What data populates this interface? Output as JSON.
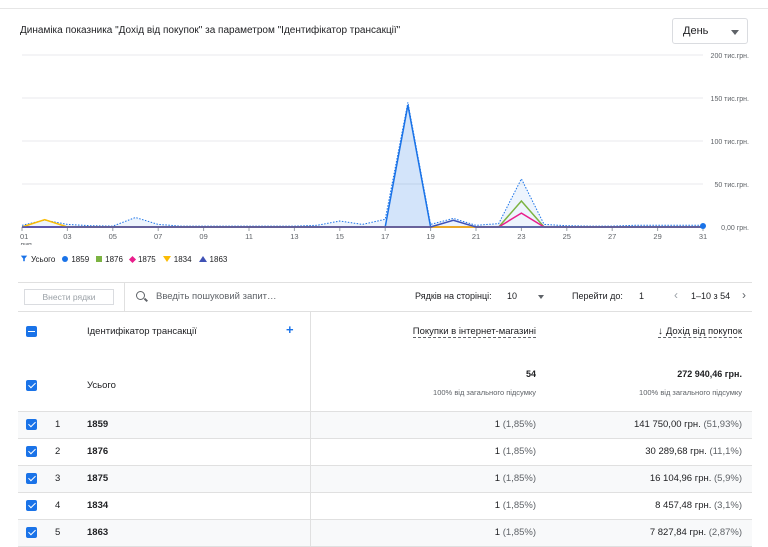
{
  "chart_title": "Динаміка показника \"Дохід від покупок\" за параметром \"Ідентифікатор трансакції\"",
  "granularity": {
    "selected": "День"
  },
  "chart_data": {
    "type": "line",
    "y_ticks": [
      "200 тис.грн.",
      "150 тис.грн.",
      "100 тис.грн.",
      "50 тис.грн.",
      "0,00 грн."
    ],
    "ylim": [
      0,
      200000
    ],
    "x_ticks": [
      "01",
      "03",
      "05",
      "07",
      "09",
      "11",
      "13",
      "15",
      "17",
      "19",
      "21",
      "23",
      "25",
      "27",
      "29",
      "31"
    ],
    "x_sub": "лип.",
    "x_days": [
      1,
      2,
      3,
      4,
      5,
      6,
      7,
      8,
      9,
      10,
      11,
      12,
      13,
      14,
      15,
      16,
      17,
      18,
      19,
      20,
      21,
      22,
      23,
      24,
      25,
      26,
      27,
      28,
      29,
      30,
      31
    ],
    "series": [
      {
        "name": "Усього",
        "color": "#1a73e8",
        "style": "dotted-area",
        "values": [
          2000,
          8000,
          3000,
          1500,
          1000,
          11000,
          3000,
          1000,
          1000,
          1000,
          1000,
          1000,
          1000,
          2000,
          7000,
          3000,
          9000,
          145000,
          3000,
          10000,
          2000,
          4000,
          56000,
          3000,
          1500,
          1000,
          1000,
          2000,
          2000,
          2000,
          2000
        ]
      },
      {
        "name": "1859",
        "color": "#1a73e8",
        "style": "area",
        "values": [
          0,
          0,
          0,
          0,
          0,
          0,
          0,
          0,
          0,
          0,
          0,
          0,
          0,
          0,
          0,
          0,
          0,
          141750,
          0,
          0,
          0,
          0,
          0,
          0,
          0,
          0,
          0,
          0,
          0,
          0,
          0
        ]
      },
      {
        "name": "1876",
        "color": "#7cb342",
        "style": "line",
        "values": [
          0,
          0,
          0,
          0,
          0,
          0,
          0,
          0,
          0,
          0,
          0,
          0,
          0,
          0,
          0,
          0,
          0,
          0,
          0,
          0,
          0,
          0,
          30290,
          0,
          0,
          0,
          0,
          0,
          0,
          0,
          0
        ]
      },
      {
        "name": "1875",
        "color": "#e91e8c",
        "style": "line",
        "values": [
          0,
          0,
          0,
          0,
          0,
          0,
          0,
          0,
          0,
          0,
          0,
          0,
          0,
          0,
          0,
          0,
          0,
          0,
          0,
          0,
          0,
          0,
          16105,
          0,
          0,
          0,
          0,
          0,
          0,
          0,
          0
        ]
      },
      {
        "name": "1834",
        "color": "#fbbc04",
        "style": "line",
        "values": [
          0,
          8457,
          0,
          0,
          0,
          0,
          0,
          0,
          0,
          0,
          0,
          0,
          0,
          0,
          0,
          0,
          0,
          0,
          0,
          0,
          0,
          0,
          0,
          0,
          0,
          0,
          0,
          0,
          0,
          0,
          0
        ]
      },
      {
        "name": "1863",
        "color": "#3f51b5",
        "style": "line",
        "values": [
          0,
          0,
          0,
          0,
          0,
          0,
          0,
          0,
          0,
          0,
          0,
          0,
          0,
          0,
          0,
          0,
          0,
          0,
          0,
          7828,
          0,
          0,
          0,
          0,
          0,
          0,
          0,
          0,
          0,
          0,
          0
        ]
      }
    ]
  },
  "legend": [
    {
      "label": "Усього",
      "shape": "drop",
      "color": "#1a73e8"
    },
    {
      "label": "1859",
      "shape": "dot",
      "color": "#1a73e8"
    },
    {
      "label": "1876",
      "shape": "square",
      "color": "#7cb342"
    },
    {
      "label": "1875",
      "shape": "diamond",
      "color": "#e91e8c"
    },
    {
      "label": "1834",
      "shape": "triangle-down",
      "color": "#fbbc04"
    },
    {
      "label": "1863",
      "shape": "triangle-up",
      "color": "#3f51b5"
    }
  ],
  "toolbar": {
    "add_rows": "Внести рядки",
    "search_placeholder": "Введіть пошуковий запит…",
    "rows_per_page_label": "Рядків на сторінці:",
    "rows_per_page": "10",
    "goto_label": "Перейти до:",
    "goto_value": "1",
    "pager_text": "1–10 з 54"
  },
  "table": {
    "dimension_header": "Ідентифікатор трансакції",
    "metric1_header": "Покупки в інтернет-магазині",
    "metric2_header": "Дохід від покупок",
    "totals": {
      "label": "Усього",
      "m1": "54",
      "m1_sub": "100% від загального підсумку",
      "m2": "272 940,46 грн.",
      "m2_sub": "100% від загального підсумку"
    },
    "rows": [
      {
        "idx": "1",
        "id": "1859",
        "m1": "1",
        "m1_pct": "(1,85%)",
        "m2": "141 750,00 грн.",
        "m2_pct": "(51,93%)"
      },
      {
        "idx": "2",
        "id": "1876",
        "m1": "1",
        "m1_pct": "(1,85%)",
        "m2": "30 289,68 грн.",
        "m2_pct": "(11,1%)"
      },
      {
        "idx": "3",
        "id": "1875",
        "m1": "1",
        "m1_pct": "(1,85%)",
        "m2": "16 104,96 грн.",
        "m2_pct": "(5,9%)"
      },
      {
        "idx": "4",
        "id": "1834",
        "m1": "1",
        "m1_pct": "(1,85%)",
        "m2": "8 457,48 грн.",
        "m2_pct": "(3,1%)"
      },
      {
        "idx": "5",
        "id": "1863",
        "m1": "1",
        "m1_pct": "(1,85%)",
        "m2": "7 827,84 грн.",
        "m2_pct": "(2,87%)"
      }
    ]
  }
}
